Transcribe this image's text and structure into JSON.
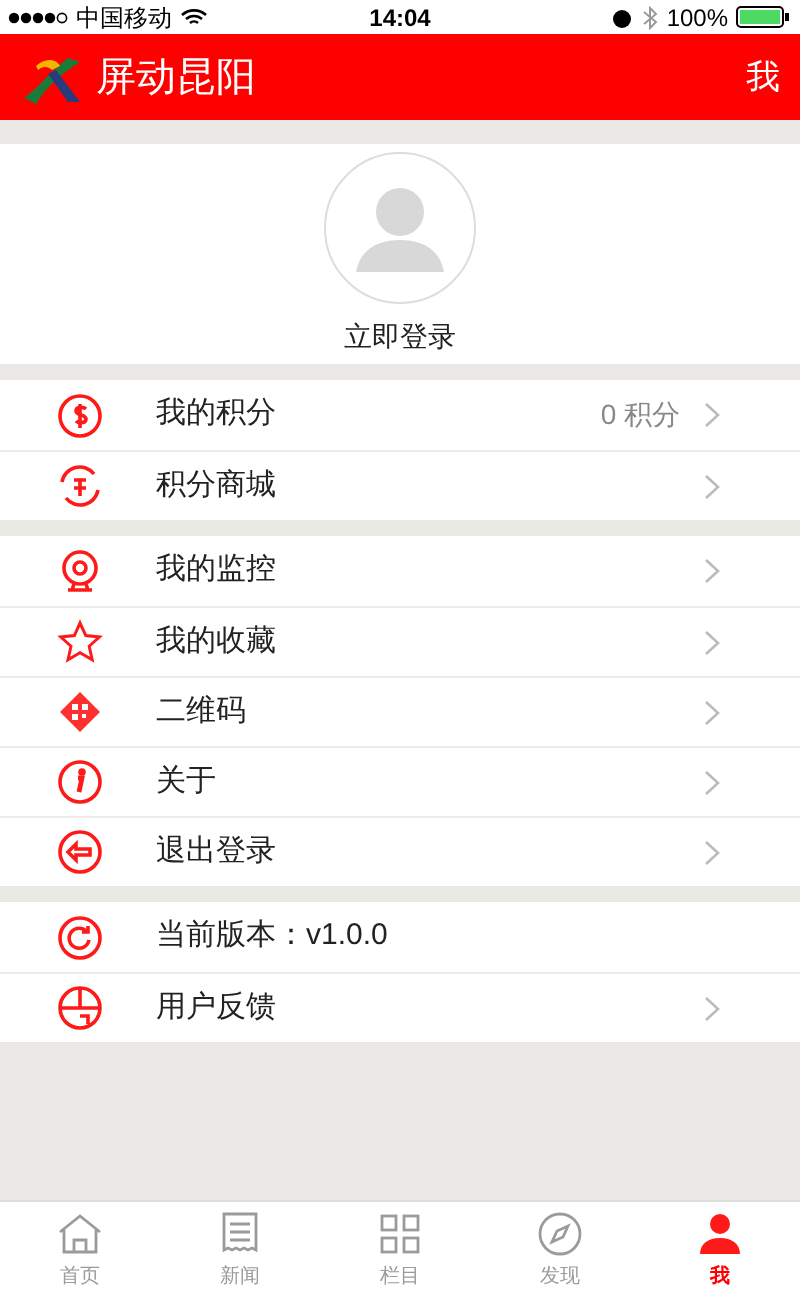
{
  "status_bar": {
    "carrier": "中国移动",
    "time": "14:04",
    "battery": "100%"
  },
  "header": {
    "title": "屏动昆阳",
    "action": "我"
  },
  "profile": {
    "login": "立即登录"
  },
  "groups": [
    [
      {
        "label": "我的积分",
        "value": "0 积分",
        "chevron": true
      },
      {
        "label": "积分商城",
        "chevron": true
      }
    ],
    [
      {
        "label": "我的监控",
        "chevron": true
      },
      {
        "label": "我的收藏",
        "chevron": true
      },
      {
        "label": "二维码",
        "chevron": true
      },
      {
        "label": "关于",
        "chevron": true
      },
      {
        "label": "退出登录",
        "chevron": true
      }
    ],
    [
      {
        "label": "当前版本：v1.0.0",
        "chevron": false
      },
      {
        "label": "用户反馈",
        "chevron": true
      }
    ]
  ],
  "tabs": [
    {
      "label": "首页",
      "selected": false
    },
    {
      "label": "新闻",
      "selected": false
    },
    {
      "label": "栏目",
      "selected": false
    },
    {
      "label": "发现",
      "selected": false
    },
    {
      "label": "我",
      "selected": true
    }
  ]
}
